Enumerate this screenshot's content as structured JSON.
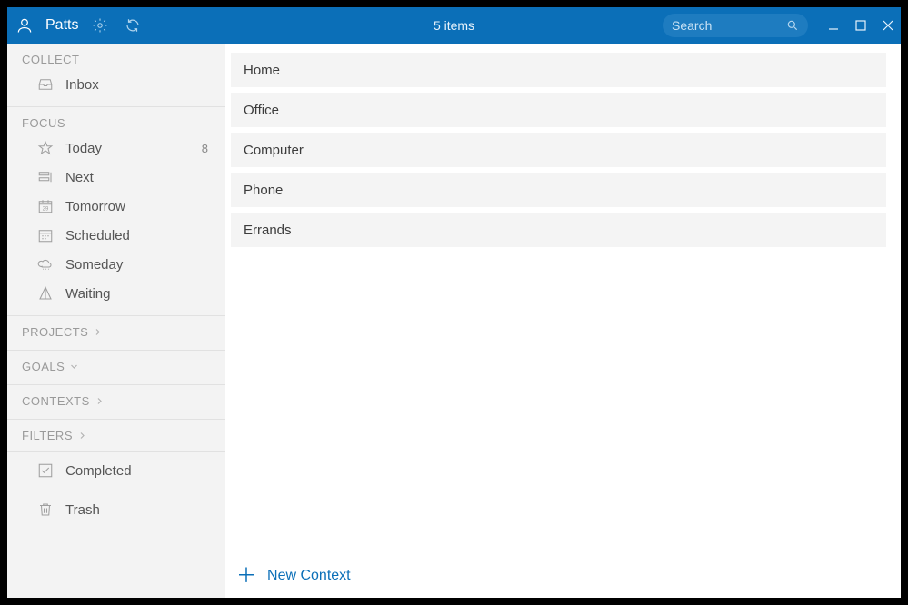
{
  "colors": {
    "accent": "#0b6fb8"
  },
  "topbar": {
    "username": "Patts",
    "item_count_label": "5 items",
    "search_placeholder": "Search"
  },
  "sidebar": {
    "collect": {
      "header": "COLLECT",
      "inbox_label": "Inbox"
    },
    "focus": {
      "header": "FOCUS",
      "items": [
        {
          "label": "Today",
          "badge": "8",
          "icon": "star"
        },
        {
          "label": "Next",
          "icon": "next"
        },
        {
          "label": "Tomorrow",
          "icon": "calendar-29"
        },
        {
          "label": "Scheduled",
          "icon": "schedule"
        },
        {
          "label": "Someday",
          "icon": "cloud"
        },
        {
          "label": "Waiting",
          "icon": "hourglass"
        }
      ]
    },
    "projects": {
      "header": "PROJECTS"
    },
    "goals": {
      "header": "GOALS"
    },
    "contexts": {
      "header": "CONTEXTS"
    },
    "filters": {
      "header": "FILTERS",
      "completed_label": "Completed",
      "trash_label": "Trash"
    }
  },
  "main": {
    "contexts": [
      {
        "label": "Home"
      },
      {
        "label": "Office"
      },
      {
        "label": "Computer"
      },
      {
        "label": "Phone"
      },
      {
        "label": "Errands"
      }
    ],
    "new_context_label": "New Context"
  }
}
